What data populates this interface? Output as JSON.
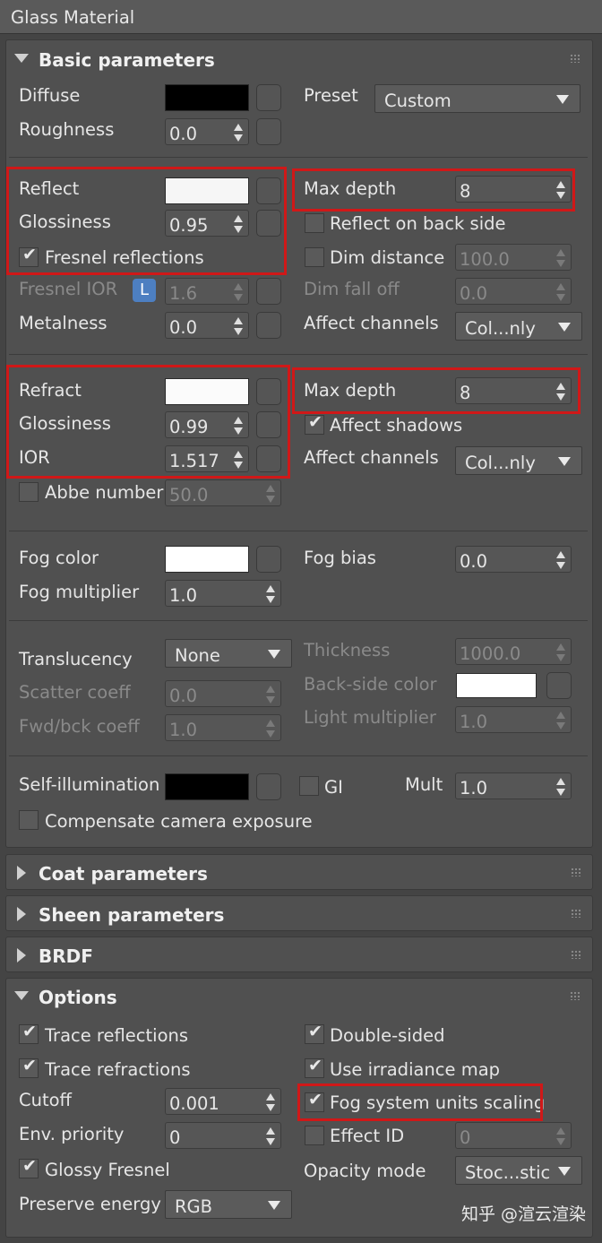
{
  "window_title": "Glass Material",
  "rollouts": {
    "basic": "Basic parameters",
    "coat": "Coat parameters",
    "sheen": "Sheen parameters",
    "brdf": "BRDF",
    "options": "Options"
  },
  "colors": {
    "diffuse": "#000000",
    "reflect": "#f6f6f6",
    "refract": "#fbfbfb",
    "fog": "#ffffff",
    "backside": "#ffffff",
    "self_illum": "#000000",
    "highlight": "#d01818"
  },
  "basic": {
    "diffuse_label": "Diffuse",
    "preset_label": "Preset",
    "preset_value": "Custom",
    "roughness_label": "Roughness",
    "roughness_value": "0.0",
    "reflect_label": "Reflect",
    "refl_glossiness_label": "Glossiness",
    "refl_glossiness_value": "0.95",
    "fresnel_label": "Fresnel reflections",
    "fresnel_checked": true,
    "max_depth_label": "Max depth",
    "refl_max_depth": "8",
    "reflect_back_label": "Reflect on back side",
    "dim_distance_label": "Dim distance",
    "dim_distance_value": "100.0",
    "fresnel_ior_label": "Fresnel IOR",
    "fresnel_ior_lock": "L",
    "fresnel_ior_value": "1.6",
    "dim_falloff_label": "Dim fall off",
    "dim_falloff_value": "0.0",
    "metalness_label": "Metalness",
    "metalness_value": "0.0",
    "affect_channels_label": "Affect channels",
    "refl_affect_channels": "Col...nly",
    "refract_label": "Refract",
    "refr_glossiness_label": "Glossiness",
    "refr_glossiness_value": "0.99",
    "refr_max_depth": "8",
    "affect_shadows_label": "Affect shadows",
    "ior_label": "IOR",
    "ior_value": "1.517",
    "refr_affect_channels": "Col...nly",
    "abbe_label": "Abbe number",
    "abbe_value": "50.0",
    "fog_color_label": "Fog color",
    "fog_bias_label": "Fog bias",
    "fog_bias_value": "0.0",
    "fog_mult_label": "Fog multiplier",
    "fog_mult_value": "1.0",
    "translucency_label": "Translucency",
    "translucency_value": "None",
    "thickness_label": "Thickness",
    "thickness_value": "1000.0",
    "scatter_label": "Scatter coeff",
    "scatter_value": "0.0",
    "backside_label": "Back-side color",
    "fwd_bck_label": "Fwd/bck coeff",
    "fwd_bck_value": "1.0",
    "light_mult_label": "Light multiplier",
    "light_mult_value": "1.0",
    "self_illum_label": "Self-illumination",
    "gi_label": "GI",
    "mult_label": "Mult",
    "mult_value": "1.0",
    "compensate_label": "Compensate camera exposure"
  },
  "options": {
    "trace_refl_label": "Trace reflections",
    "double_sided_label": "Double-sided",
    "trace_refr_label": "Trace refractions",
    "irradiance_label": "Use irradiance map",
    "cutoff_label": "Cutoff",
    "cutoff_value": "0.001",
    "fog_units_label": "Fog system units scaling",
    "env_priority_label": "Env. priority",
    "env_priority_value": "0",
    "effect_id_label": "Effect ID",
    "effect_id_value": "0",
    "glossy_fresnel_label": "Glossy Fresnel",
    "opacity_mode_label": "Opacity mode",
    "opacity_mode_value": "Stoc...stic",
    "preserve_energy_label": "Preserve energy",
    "preserve_energy_value": "RGB"
  },
  "watermark": "知乎 @渲云渲染"
}
